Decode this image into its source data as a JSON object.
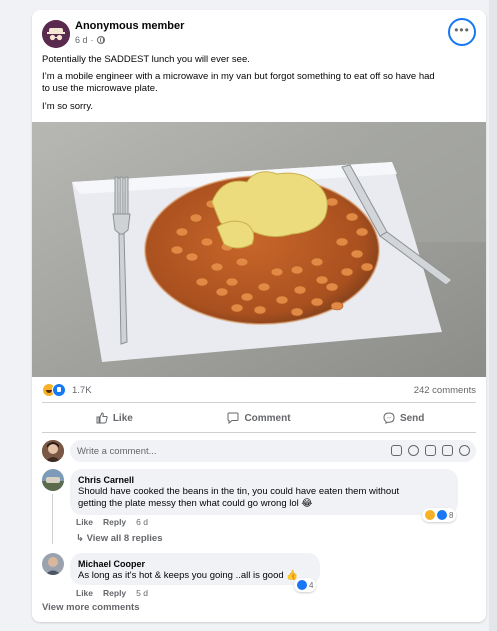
{
  "post": {
    "author": "Anonymous member",
    "time": "6 d",
    "separator": "·",
    "more_label": "•••",
    "lines": [
      "Potentially the SADDEST lunch you will ever see.",
      "I’m a mobile engineer with a microwave in my van but forgot something to eat off so have had",
      "to use the microwave plate.",
      "I’m so sorry."
    ],
    "reaction_count": "1.7K",
    "comment_count": "242 comments",
    "icons": [
      "more-icon",
      "globe-icon",
      "haha-reaction-icon",
      "like-reaction-icon"
    ]
  },
  "actions": {
    "like": "Like",
    "comment": "Comment",
    "send": "Send"
  },
  "comment_box": {
    "placeholder": "Write a comment..."
  },
  "comments": [
    {
      "name": "Chris Carnell",
      "text_line1": "Should have cooked the beans in the tin, you could have eaten them without",
      "text_line2": "getting the plate messy then what could go wrong lol 😂",
      "like": "Like",
      "reply": "Reply",
      "time": "6 d",
      "reaction_count": "8",
      "view_replies": "View all 8 replies"
    },
    {
      "name": "Michael Cooper",
      "text": "As long as it's hot & keeps you going ..all is good 👍",
      "like": "Like",
      "reply": "Reply",
      "time": "5 d",
      "reaction_count": "4"
    }
  ],
  "view_more": "View more comments",
  "colors": {
    "accent": "#1877f2",
    "muted_text": "#65676b",
    "bubble": "#f0f2f5",
    "beans": "#d9762f"
  }
}
